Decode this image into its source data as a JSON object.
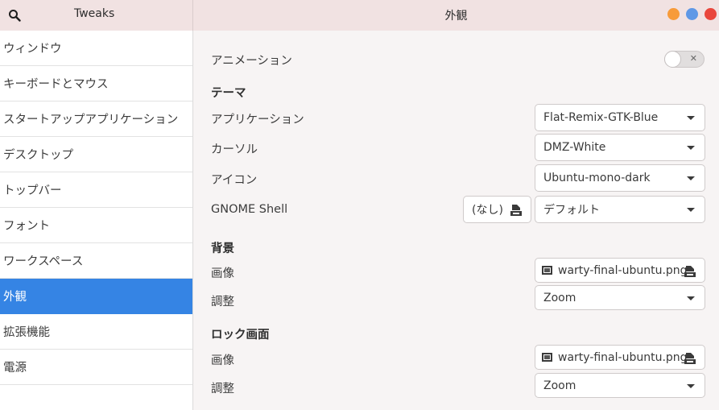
{
  "header": {
    "app_title": "Tweaks",
    "page_title": "外観",
    "search_icon": "search-icon",
    "window_buttons": [
      {
        "name": "minimize",
        "color": "#f79b3a"
      },
      {
        "name": "maximize",
        "color": "#5f98e6"
      },
      {
        "name": "close",
        "color": "#e9463c"
      }
    ]
  },
  "sidebar": {
    "items": [
      {
        "label": "ウィンドウ"
      },
      {
        "label": "キーボードとマウス"
      },
      {
        "label": "スタートアップアプリケーション"
      },
      {
        "label": "デスクトップ"
      },
      {
        "label": "トップバー"
      },
      {
        "label": "フォント"
      },
      {
        "label": "ワークスペース"
      },
      {
        "label": "外観",
        "active": true
      },
      {
        "label": "拡張機能"
      },
      {
        "label": "電源"
      }
    ],
    "active_color": "#3584e4"
  },
  "main": {
    "animation": {
      "label": "アニメーション",
      "toggle_on": false
    },
    "theme_section": "テーマ",
    "themes": {
      "application": {
        "label": "アプリケーション",
        "value": "Flat-Remix-GTK-Blue"
      },
      "cursor": {
        "label": "カーソル",
        "value": "DMZ-White"
      },
      "icons": {
        "label": "アイコン",
        "value": "Ubuntu-mono-dark"
      },
      "shell": {
        "label": "GNOME Shell",
        "file_value": "(なし)",
        "value": "デフォルト"
      }
    },
    "background_section": "背景",
    "background": {
      "image": {
        "label": "画像",
        "value": "warty-final-ubuntu.png"
      },
      "adjust": {
        "label": "調整",
        "value": "Zoom"
      }
    },
    "lockscreen_section": "ロック画面",
    "lockscreen": {
      "image": {
        "label": "画像",
        "value": "warty-final-ubuntu.png"
      },
      "adjust": {
        "label": "調整",
        "value": "Zoom"
      }
    }
  }
}
